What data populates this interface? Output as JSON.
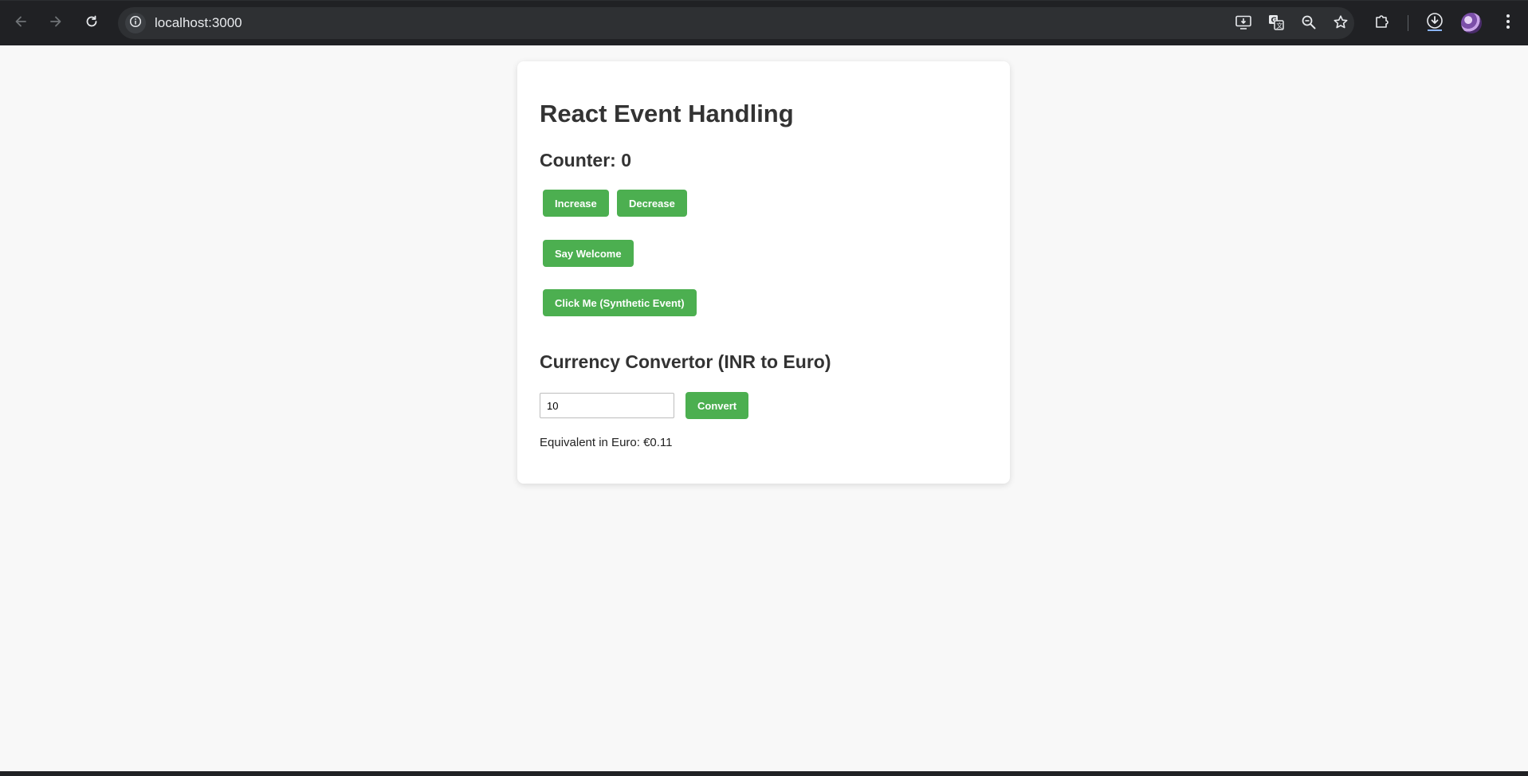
{
  "browser": {
    "url": "localhost:3000",
    "icons": {
      "back": "arrow-left-icon",
      "forward": "arrow-right-icon",
      "reload": "reload-icon",
      "site_info": "info-icon",
      "install": "install-app-icon",
      "translate": "translate-icon",
      "zoom": "zoom-icon",
      "bookmark": "star-icon",
      "extensions": "puzzle-icon",
      "downloads": "download-icon",
      "menu": "kebab-menu-icon"
    }
  },
  "app": {
    "title": "React Event Handling",
    "counter_label": "Counter: 0",
    "buttons": {
      "increase": "Increase",
      "decrease": "Decrease",
      "say_welcome": "Say Welcome",
      "synthetic": "Click Me (Synthetic Event)",
      "convert": "Convert"
    },
    "converter": {
      "title": "Currency Convertor (INR to Euro)",
      "amount_value": "10",
      "result": "Equivalent in Euro: €0.11"
    }
  },
  "colors": {
    "accent": "#4caf50",
    "chrome_bg": "#202124",
    "page_bg": "#f8f8f8",
    "card_bg": "#ffffff"
  }
}
